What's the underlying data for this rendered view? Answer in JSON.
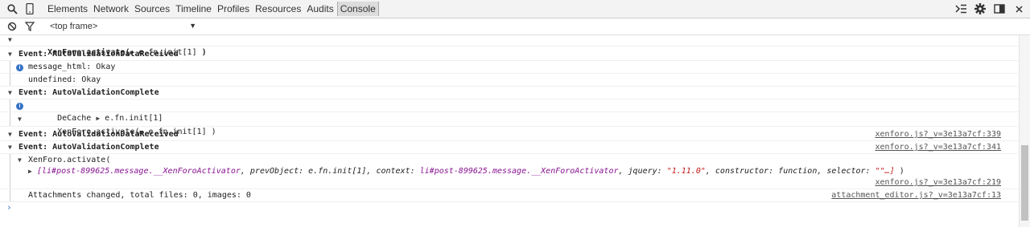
{
  "toolbar": {
    "tabs": [
      "Elements",
      "Network",
      "Sources",
      "Timeline",
      "Profiles",
      "Resources",
      "Audits",
      "Console"
    ],
    "active_tab": "Console"
  },
  "filter": {
    "frame": "<top frame>"
  },
  "lines": {
    "l1_prefix": "XenForo.activate(",
    "l1_obj": "e.fn.init[1]",
    "l1_suffix": " )",
    "l2": "Event: AutoValidationDataReceived",
    "l3": "message_html: Okay",
    "l4": "undefined: Okay",
    "l5": "Event: AutoValidationComplete",
    "l6_prefix": "DeCache",
    "l6_obj": "e.fn.init[1]",
    "l7_prefix": "XenForo.activate(",
    "l7_obj": "e.fn.init[1]",
    "l7_suffix": " )",
    "l8": "Event: AutoValidationDataReceived",
    "l8_src": "xenforo.js?_v=3e13a7cf:339",
    "l9": "Event: AutoValidationComplete",
    "l9_src": "xenforo.js?_v=3e13a7cf:341",
    "l10": "XenForo.activate(",
    "l11_a": "[li#post-899625.message.__XenForoActivator",
    "l11_b": ", prevObject: e.fn.init[1], context: ",
    "l11_c": "li#post-899625.message.__XenForoActivator",
    "l11_d": ", jquery: ",
    "l11_e": "\"1.11.0\"",
    "l11_f": ", constructor: function, selector: ",
    "l11_g": "\"\"…]",
    "l11_h": " )",
    "l12_src": "xenforo.js?_v=3e13a7cf:219",
    "l13": "Attachments changed, total files: 0, images: 0",
    "l13_src": "attachment_editor.js?_v=3e13a7cf:13"
  }
}
